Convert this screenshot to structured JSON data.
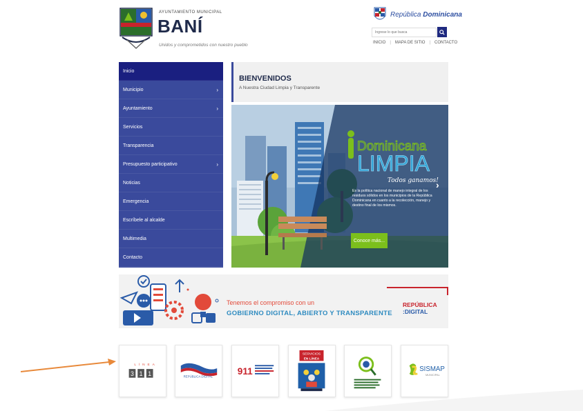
{
  "header": {
    "org_small": "AYUNTAMIENTO MUNICIPAL",
    "org_name": "BANÍ",
    "tagline": "Unidos y comprometidos con nuestro pueblo",
    "gov_brand_prefix": "República",
    "gov_brand_name": "Dominicana",
    "search_placeholder": "Ingrese lo que busca",
    "top_links": [
      "INICIO",
      "MAPA DE SITIO",
      "CONTACTO"
    ]
  },
  "sidebar": {
    "items": [
      {
        "label": "Inicio",
        "has_chevron": false,
        "active": true
      },
      {
        "label": "Municipio",
        "has_chevron": true,
        "active": false
      },
      {
        "label": "Ayuntamiento",
        "has_chevron": true,
        "active": false
      },
      {
        "label": "Servicios",
        "has_chevron": false,
        "active": false
      },
      {
        "label": "Transparencia",
        "has_chevron": false,
        "active": false
      },
      {
        "label": "Presupuesto participativo",
        "has_chevron": true,
        "active": false
      },
      {
        "label": "Noticias",
        "has_chevron": false,
        "active": false
      },
      {
        "label": "Emergencia",
        "has_chevron": false,
        "active": false
      },
      {
        "label": "Escríbele al alcalde",
        "has_chevron": false,
        "active": false
      },
      {
        "label": "Multimedia",
        "has_chevron": false,
        "active": false
      },
      {
        "label": "Contacto",
        "has_chevron": false,
        "active": false
      }
    ],
    "chevron": "›"
  },
  "welcome": {
    "title": "BIENVENIDOS",
    "subtitle": "A Nuestra Ciudad Limpia y Transparente"
  },
  "slide": {
    "logo_line1": "Dominicana",
    "logo_line2": "LIMPIA",
    "logo_slogan": "Todos ganamos!",
    "body": "Es la política nacional de manejo integral de los residuos sólidos en los municipios de la República Dominicana en cuanto a la recolección, manejo y destino final de los mismos.",
    "button": "Conoce más...",
    "next": "›"
  },
  "banner": {
    "line1": "Tenemos el compromiso con un",
    "line2": "GOBIERNO DIGITAL, ABIERTO Y TRANSPARENTE",
    "rd_line1": "REPÚBLICA",
    "rd_line2": ":DIGITAL"
  },
  "tiles": [
    {
      "name": "linea-311",
      "top_text": "LÍNEA",
      "digits": [
        "3",
        "1",
        "1"
      ]
    },
    {
      "name": "republica-digital",
      "text": "REPÚBLICA DIGITAL"
    },
    {
      "name": "emergencias-911",
      "number": "911",
      "caption": "TODOS LOS SERVICIOS DE EMERGENCIA EN UN SOLO NÚMERO"
    },
    {
      "name": "servicios-en-linea",
      "line1": "SERVICIOS",
      "line2": "EN LÍNEA"
    },
    {
      "name": "observatorio",
      "caption": "Observatorio Nacional de la Calidad de los Servicios Públicos"
    },
    {
      "name": "sismap",
      "title": "SISMAP",
      "subtitle": "MUNICIPAL"
    }
  ],
  "colors": {
    "sidebar_bg": "#3a4a9c",
    "sidebar_active": "#1a1f80",
    "accent_green": "#7cbf1c",
    "arrow": "#e8893a",
    "banner_red": "#e24a3a",
    "banner_blue": "#2e8bc0"
  }
}
